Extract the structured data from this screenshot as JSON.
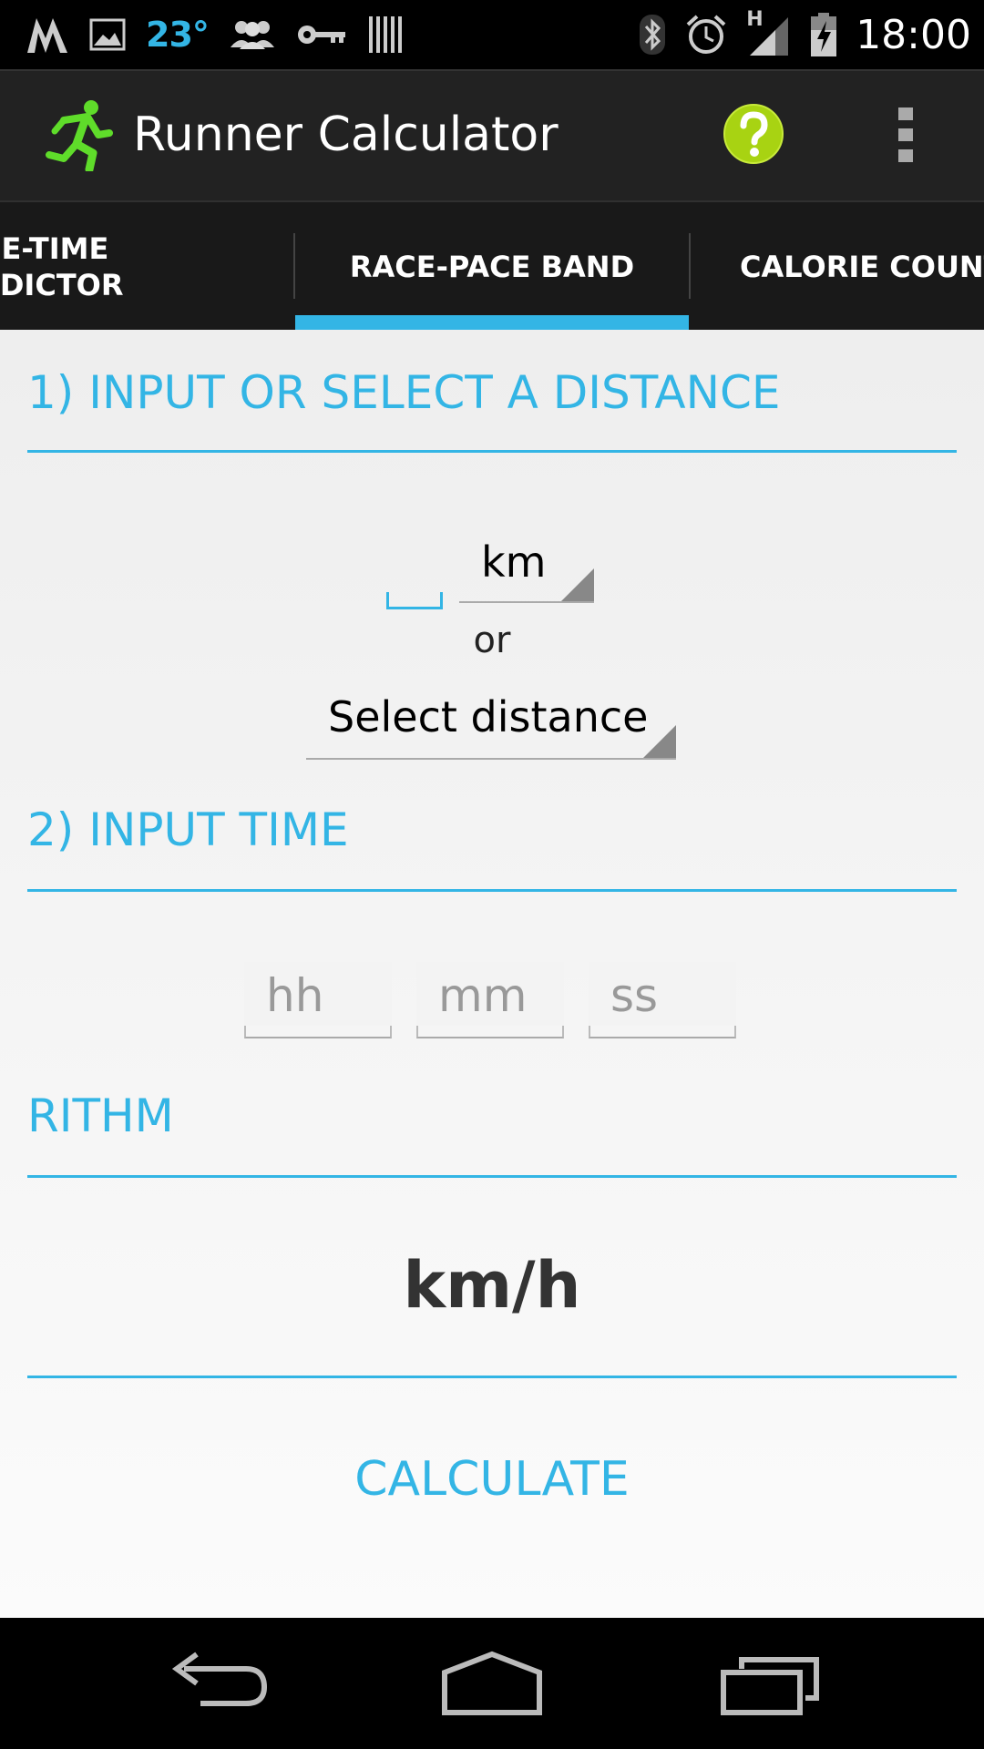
{
  "status_bar": {
    "temperature": "23°",
    "time": "18:00",
    "network_label": "H",
    "icons": [
      "m-app-icon",
      "gallery-icon",
      "weather-temp",
      "people-icon",
      "key-icon",
      "barcode-icon",
      "bluetooth-icon",
      "alarm-icon",
      "signal-icon",
      "battery-charging-icon"
    ]
  },
  "action_bar": {
    "title": "Runner Calculator",
    "help_icon": "help-icon",
    "overflow_icon": "overflow-menu-icon",
    "app_icon": "runner-icon",
    "accent": "#33b5e5"
  },
  "tabs": [
    {
      "label": "CE-TIME\nEDICTOR"
    },
    {
      "label": "RACE-PACE BAND"
    },
    {
      "label": "CALORIE COUNT"
    }
  ],
  "sections": {
    "distance_title": "1) INPUT OR SELECT A DISTANCE",
    "time_title": "2) INPUT TIME",
    "rhythm_title": "RITHM"
  },
  "distance": {
    "value": "",
    "unit": "km",
    "or_label": "or",
    "select_label": "Select distance"
  },
  "time": {
    "hh_placeholder": "hh",
    "mm_placeholder": "mm",
    "ss_placeholder": "ss"
  },
  "result": {
    "unit": "km/h"
  },
  "calculate_label": "CALCULATE",
  "nav": [
    "back-icon",
    "home-icon",
    "recents-icon"
  ]
}
